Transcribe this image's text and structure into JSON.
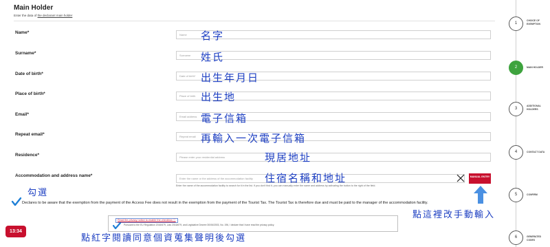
{
  "header": {
    "title": "Main Holder",
    "subtitle_prefix": "Enter the data of",
    "subtitle_link": "the declarant main holder"
  },
  "fields": [
    {
      "label": "Name*",
      "placeholder": "Name",
      "note": "名字"
    },
    {
      "label": "Surname*",
      "placeholder": "Surname",
      "note": "姓氏"
    },
    {
      "label": "Date of birth*",
      "placeholder": "Date of birth*",
      "note": "出生年月日"
    },
    {
      "label": "Place of birth*",
      "placeholder": "Place of birth",
      "note": "出生地"
    },
    {
      "label": "Email*",
      "placeholder": "Email address",
      "note": "電子信箱"
    },
    {
      "label": "Repeat email*",
      "placeholder": "Repeat email",
      "note": "再輸入一次電子信箱"
    },
    {
      "label": "Residence*",
      "placeholder": "Please enter your residential address",
      "note": "現居地址"
    },
    {
      "label": "Accommodation and address name*",
      "placeholder": "Enter the name or the address of the accommodation facility",
      "note": "住宿名稱和地址"
    }
  ],
  "accommodation": {
    "help_text": "Enter the name of the accommodation facility to search for it in the list. If you don't find it, you can manually enter the name and address by activating the button to the right of the field.",
    "manual_button": "MANUAL ENTRY"
  },
  "declaration": {
    "text": "Declares to be aware that the exemption from the payment of the Access Fee does not result in the exemption from the payment of the Tourist Tax. The Tourist Tax is therefore due and must be paid to the manager of the accommodation facility.",
    "privacy_link": "Read the privacy notice to enable the checkbox ⓘ",
    "privacy_text": "Pursuant to the EU Regulation 2016/679, Law 2016/679, and Legislative Decree 30/06/2003, No. 196, I declare that I have read the privacy policy."
  },
  "annotations": {
    "check_note": "勾選",
    "manual_note": "點這裡改手動輸入",
    "privacy_note": "點紅字閱讀同意個資蒐集聲明後勾選"
  },
  "timer": "13:34",
  "steps": [
    {
      "num": "1",
      "label": "CHOICE OF EXEMPTION"
    },
    {
      "num": "2",
      "label": "MAIN HOLDER",
      "active": true
    },
    {
      "num": "3",
      "label": "ADDITIONAL HOLDERS"
    },
    {
      "num": "4",
      "label": "CONTACT DATA"
    },
    {
      "num": "5",
      "label": "CONFIRM"
    },
    {
      "num": "6",
      "label": "GENERATED CODES"
    }
  ],
  "colors": {
    "accent_red": "#c8102e",
    "step_active_green": "#3ea33e",
    "annotation_blue": "#1d3fc2"
  }
}
